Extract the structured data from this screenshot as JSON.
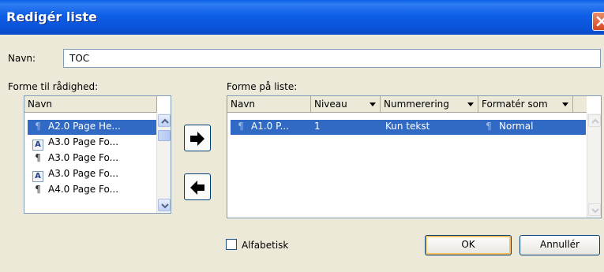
{
  "window": {
    "title": "Redigér liste"
  },
  "name_field": {
    "label": "Navn:",
    "value": "TOC"
  },
  "available": {
    "label": "Forme til rådighed:",
    "column": "Navn",
    "items": [
      {
        "label": "A2.0 Page He...",
        "icon": "paragraph-style-icon",
        "selected": true
      },
      {
        "label": "A3.0 Page Fo...",
        "icon": "character-style-icon",
        "selected": false
      },
      {
        "label": "A3.0 Page Fo...",
        "icon": "paragraph-style-icon",
        "selected": false
      },
      {
        "label": "A3.0 Page Fo...",
        "icon": "character-style-icon",
        "selected": false
      },
      {
        "label": "A4.0 Page Fo...",
        "icon": "paragraph-style-icon",
        "selected": false
      }
    ]
  },
  "on_list": {
    "label": "Forme på liste:",
    "columns": [
      "Navn",
      "Niveau",
      "Nummerering",
      "Formatér som"
    ],
    "rows": [
      {
        "name": "A1.0 P...",
        "level": "1",
        "numbering": "Kun tekst",
        "format": "Normal",
        "selected": true
      }
    ]
  },
  "buttons": {
    "add": "arrow-right-icon",
    "remove": "arrow-left-icon",
    "ok": "OK",
    "cancel": "Annullér"
  },
  "alphabetical": {
    "label": "Alfabetisk",
    "checked": false
  },
  "colors": {
    "titlebar": "#0a5fe6",
    "selection": "#316ac5",
    "dialog_bg": "#ece9d8",
    "default_button_ring": "#f5c062"
  }
}
